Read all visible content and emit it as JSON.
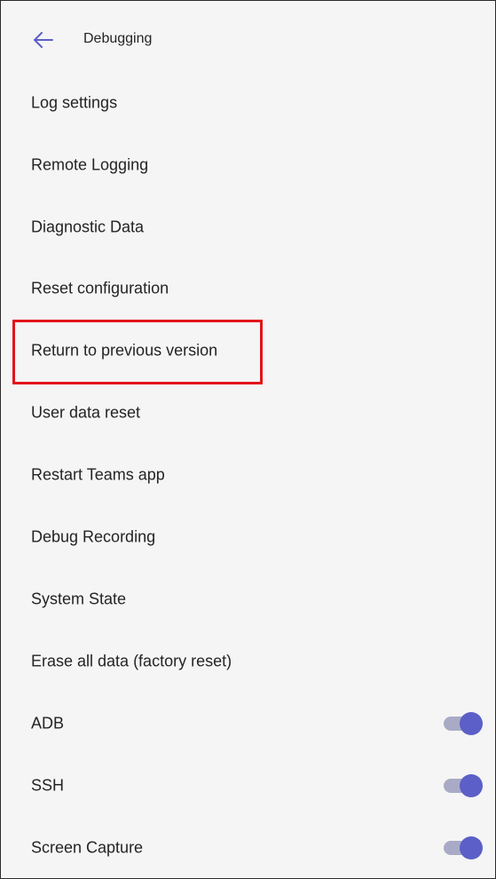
{
  "header": {
    "title": "Debugging",
    "back_icon": "arrow-left-icon"
  },
  "items": [
    {
      "label": "Log settings"
    },
    {
      "label": "Remote Logging"
    },
    {
      "label": "Diagnostic Data"
    },
    {
      "label": "Reset configuration"
    },
    {
      "label": "Return to previous version",
      "highlighted": true
    },
    {
      "label": "User data reset"
    },
    {
      "label": "Restart Teams app"
    },
    {
      "label": "Debug Recording"
    },
    {
      "label": "System State"
    },
    {
      "label": "Erase all data (factory reset)"
    }
  ],
  "toggles": [
    {
      "label": "ADB",
      "on": true
    },
    {
      "label": "SSH",
      "on": true
    },
    {
      "label": "Screen Capture",
      "on": true
    }
  ],
  "colors": {
    "accent": "#5b5fc7",
    "toggle_track": "#a9abc6",
    "highlight_border": "#e3141b",
    "background": "#f5f5f5",
    "text": "#242424"
  }
}
